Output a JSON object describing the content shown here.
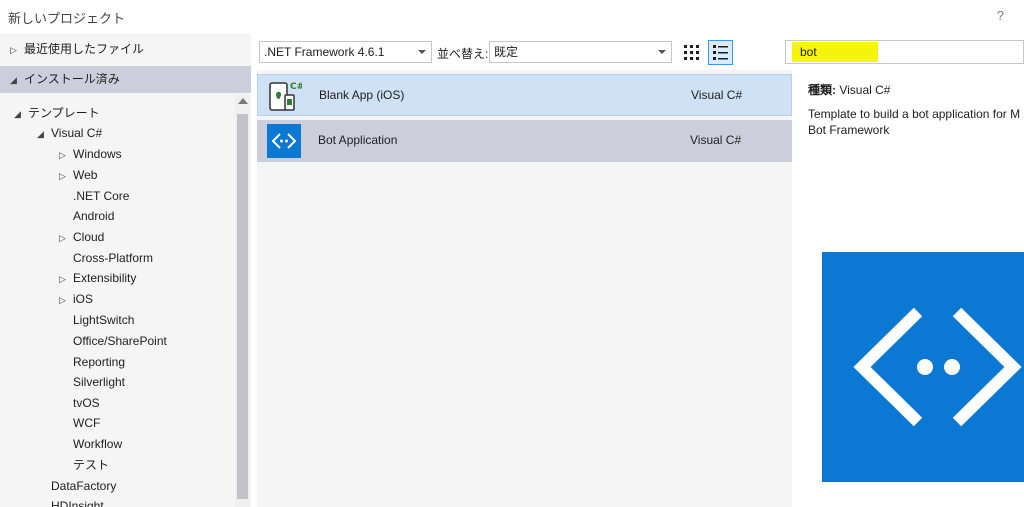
{
  "window": {
    "title": "新しいプロジェクト",
    "help": "?"
  },
  "tree": {
    "installed": "インストール済み",
    "recent": "最近使用したファイル",
    "templates": "テンプレート",
    "visual_csharp": "Visual C#",
    "children": [
      "Windows",
      "Web",
      ".NET Core",
      "Android",
      "Cloud",
      "Cross-Platform",
      "Extensibility",
      "iOS",
      "LightSwitch",
      "Office/SharePoint",
      "Reporting",
      "Silverlight",
      "tvOS",
      "WCF",
      "Workflow",
      "テスト"
    ],
    "after": [
      "DataFactory",
      "HDInsight"
    ]
  },
  "toolbar": {
    "framework": ".NET Framework 4.6.1",
    "sort_label": "並べ替え:",
    "sort_value": "既定"
  },
  "search": {
    "value": "bot"
  },
  "templates": [
    {
      "name": "Blank App (iOS)",
      "lang": "Visual C#",
      "icon": "blank-app-ios-icon",
      "badge": "C#"
    },
    {
      "name": "Bot Application",
      "lang": "Visual C#",
      "icon": "bot-application-icon"
    }
  ],
  "detail": {
    "kind_label": "種類:",
    "kind_value": "Visual C#",
    "desc1": "Template to build a bot application for M",
    "desc2": "Bot Framework"
  },
  "colors": {
    "accent": "#0b78d4",
    "selected": "#cccedb",
    "highlight": "#f5f50c",
    "hover": "#cfe1f5"
  }
}
